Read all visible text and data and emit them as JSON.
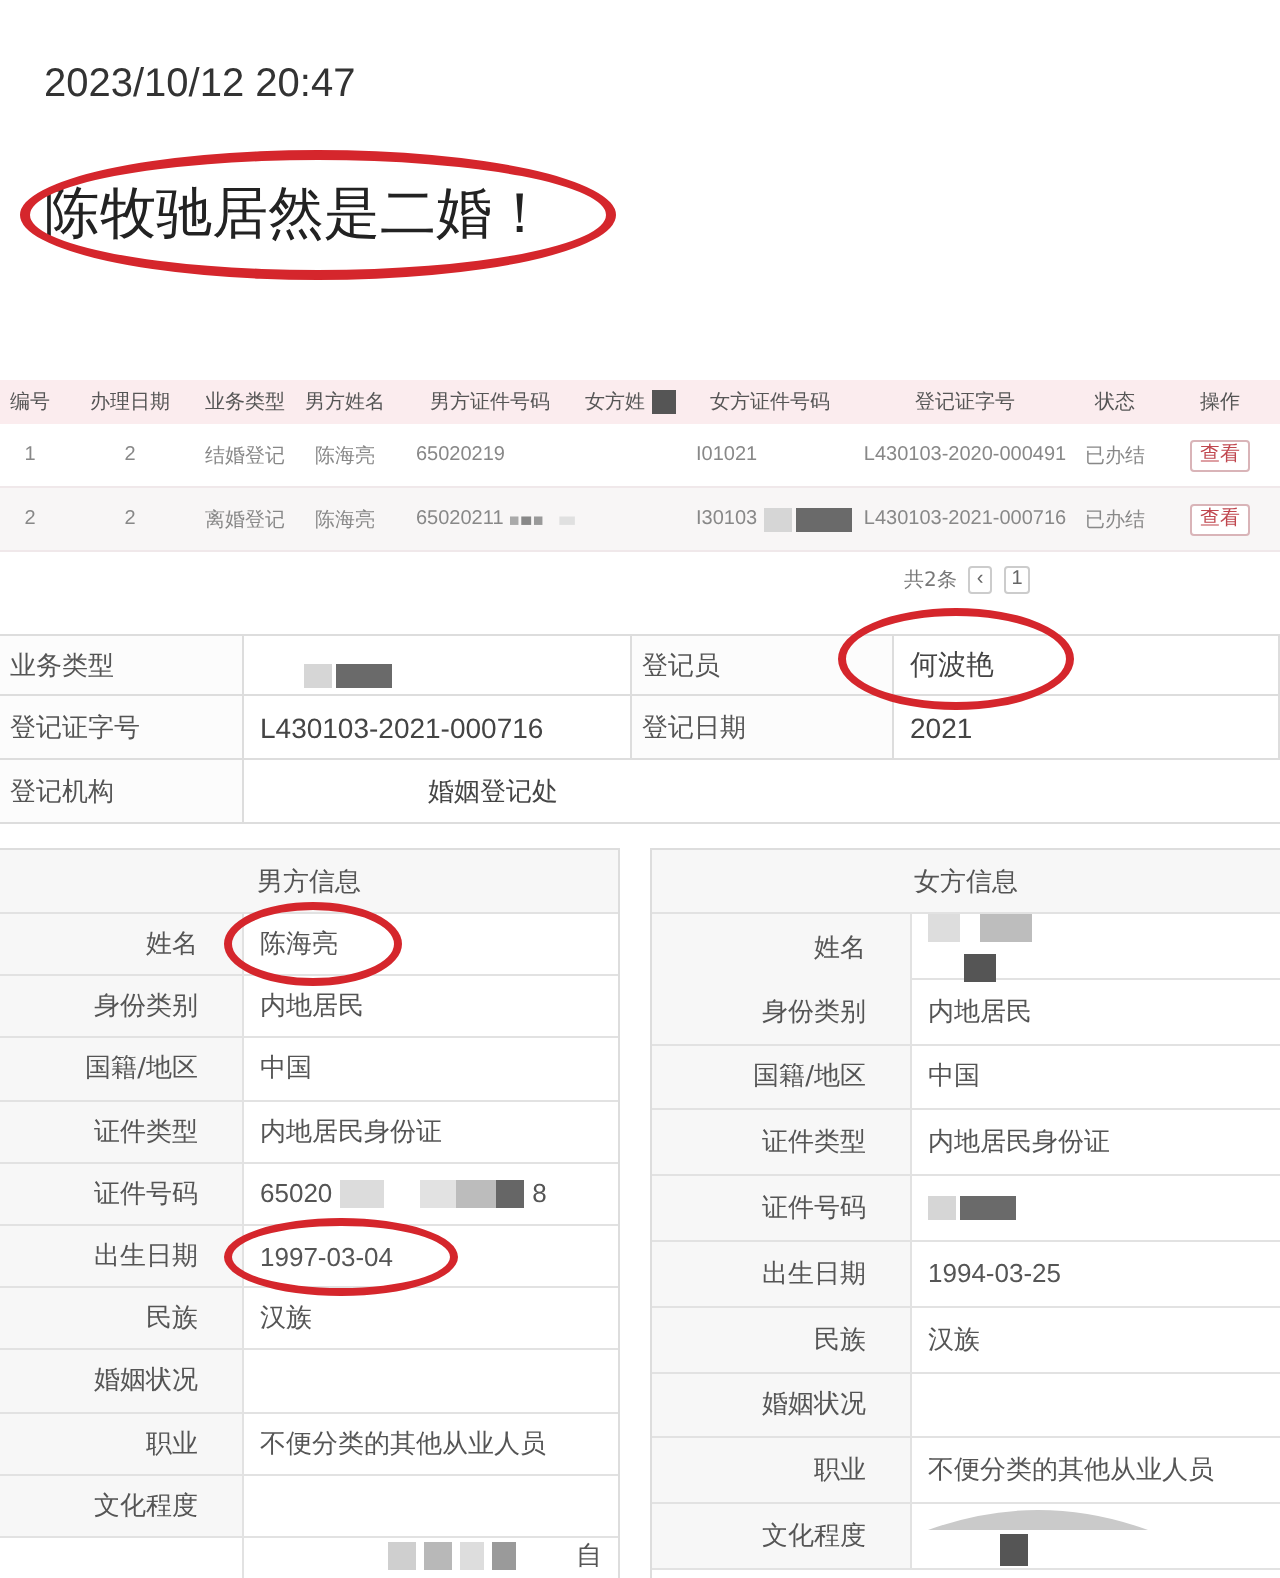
{
  "post": {
    "time": "2023/10/12 20:47",
    "text": "陈牧驰居然是二婚！",
    "circled": true
  },
  "record_list": {
    "columns": [
      {
        "label": "编号"
      },
      {
        "label": "办理日期"
      },
      {
        "label": "业务类型"
      },
      {
        "label": "男方姓名"
      },
      {
        "label": "男方证件号码"
      },
      {
        "label": "女方姓",
        "redacted": true
      },
      {
        "label": "女方证件号码"
      },
      {
        "label": "登记证字号"
      },
      {
        "label": "状态"
      },
      {
        "label": "操作"
      }
    ],
    "rows": [
      {
        "no": "1",
        "date": "2",
        "type": "结婚登记",
        "male_name": "陈海亮",
        "male_id": "65020219",
        "female_id": "I01021",
        "cert_no": "L430103-2020-000491",
        "status": "已办结",
        "action": "查看",
        "redacted": false
      },
      {
        "no": "2",
        "date": "2",
        "type": "离婚登记",
        "male_name": "陈海亮",
        "male_id": "65020211",
        "female_id": "I30103",
        "cert_no": "L430103-2021-000716",
        "status": "已办结",
        "action": "查看",
        "redacted": true
      }
    ]
  },
  "pagination": {
    "total": "共2条",
    "prev": "‹",
    "page": "1"
  },
  "details": {
    "rows": [
      {
        "cells": [
          {
            "kind": "label",
            "text": "业务类型"
          },
          {
            "kind": "value",
            "redacted": true
          },
          {
            "kind": "label",
            "text": "登记员"
          },
          {
            "kind": "value",
            "text": "何波艳",
            "circled": true
          }
        ]
      },
      {
        "cells": [
          {
            "kind": "label",
            "text": "登记证字号"
          },
          {
            "kind": "value",
            "text": "L430103-2021-000716"
          },
          {
            "kind": "label",
            "text": "登记日期"
          },
          {
            "kind": "value",
            "text": "2021"
          }
        ]
      },
      {
        "cells": [
          {
            "kind": "label",
            "text": "登记机构"
          },
          {
            "kind": "wide",
            "text": "婚姻登记处"
          }
        ]
      }
    ]
  },
  "panels": [
    {
      "title": "男方信息",
      "rows": [
        {
          "label": "姓名",
          "value": "陈海亮",
          "circled": true
        },
        {
          "label": "身份类别",
          "value": "内地居民"
        },
        {
          "label": "国籍/地区",
          "value": "中国"
        },
        {
          "label": "证件类型",
          "value": "内地居民身份证"
        },
        {
          "label": "证件号码",
          "value": "65020",
          "redacted": true,
          "value_end": "8"
        },
        {
          "label": "出生日期",
          "value": "1997-03-04",
          "circled": true
        },
        {
          "label": "民族",
          "value": "汉族"
        },
        {
          "label": "婚姻状况"
        },
        {
          "label": "职业",
          "value": "不便分类的其他从业人员"
        },
        {
          "label": "文化程度"
        },
        {
          "redacted": true,
          "value_end": "自"
        }
      ]
    },
    {
      "title": "女方信息",
      "rows": [
        {
          "label": "姓名",
          "redacted": true
        },
        {
          "label": "身份类别",
          "value": "内地居民"
        },
        {
          "label": "国籍/地区",
          "value": "中国"
        },
        {
          "label": "证件类型",
          "value": "内地居民身份证"
        },
        {
          "label": "证件号码",
          "redacted": true
        },
        {
          "label": "出生日期",
          "value": "1994-03-25"
        },
        {
          "label": "民族",
          "value": "汉族"
        },
        {
          "label": "婚姻状况"
        },
        {
          "label": "职业",
          "value": "不便分类的其他从业人员"
        },
        {
          "label": "文化程度",
          "redacted": true
        }
      ]
    }
  ]
}
